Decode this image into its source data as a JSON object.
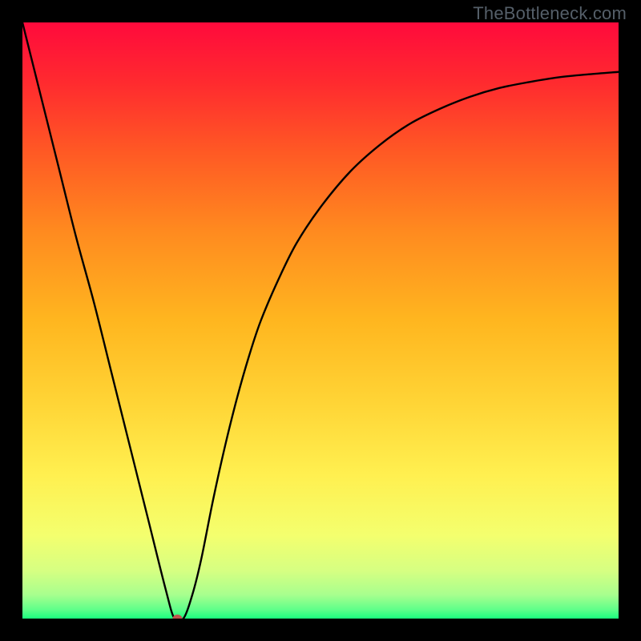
{
  "watermark": "TheBottleneck.com",
  "chart_data": {
    "type": "line",
    "title": "",
    "xlabel": "",
    "ylabel": "",
    "xlim": [
      0,
      100
    ],
    "ylim": [
      0,
      100
    ],
    "grid": false,
    "series": [
      {
        "name": "curve",
        "x": [
          0,
          3,
          6,
          9,
          12,
          15,
          18,
          21,
          24,
          25.5,
          27,
          28.5,
          30,
          32,
          34,
          36,
          38,
          40,
          43,
          46,
          50,
          55,
          60,
          65,
          70,
          75,
          80,
          85,
          90,
          95,
          100
        ],
        "y": [
          100,
          88,
          76,
          64,
          53,
          41,
          29,
          17,
          5,
          0,
          0,
          4,
          10,
          20,
          29,
          37,
          44,
          50,
          57,
          63,
          69,
          75,
          79.5,
          83,
          85.5,
          87.5,
          89,
          90,
          90.8,
          91.3,
          91.7
        ]
      }
    ],
    "marker": {
      "x": 26,
      "y": 0
    },
    "background_gradient": {
      "stops": [
        {
          "offset": 0.0,
          "color": "#ff0a3c"
        },
        {
          "offset": 0.1,
          "color": "#ff2a2f"
        },
        {
          "offset": 0.22,
          "color": "#ff5a24"
        },
        {
          "offset": 0.35,
          "color": "#ff8a1f"
        },
        {
          "offset": 0.5,
          "color": "#ffb61f"
        },
        {
          "offset": 0.64,
          "color": "#ffd536"
        },
        {
          "offset": 0.76,
          "color": "#fff050"
        },
        {
          "offset": 0.86,
          "color": "#f4ff6e"
        },
        {
          "offset": 0.92,
          "color": "#d6ff82"
        },
        {
          "offset": 0.96,
          "color": "#a8ff8e"
        },
        {
          "offset": 0.985,
          "color": "#5fff8a"
        },
        {
          "offset": 1.0,
          "color": "#1aff7e"
        }
      ]
    }
  }
}
